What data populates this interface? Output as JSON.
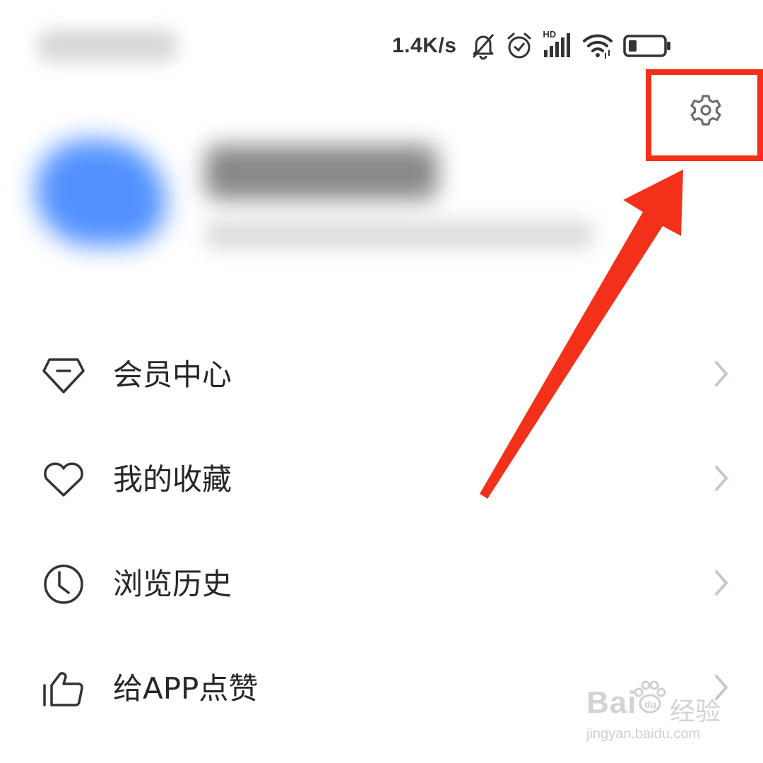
{
  "status_bar": {
    "net_speed": "1.4K/s",
    "icons": [
      "bell-muted-icon",
      "alarm-icon",
      "hd-signal-icon",
      "wifi-icon",
      "battery-icon"
    ],
    "hd_label": "HD"
  },
  "header": {
    "settings_icon": "gear-icon"
  },
  "menu": {
    "items": [
      {
        "label": "会员中心",
        "icon": "diamond-icon"
      },
      {
        "label": "我的收藏",
        "icon": "heart-icon"
      },
      {
        "label": "浏览历史",
        "icon": "clock-icon"
      },
      {
        "label": "给APP点赞",
        "icon": "thumbs-up-icon"
      }
    ]
  },
  "annotation": {
    "highlight_color": "#f3301a"
  },
  "watermark": {
    "brand_left": "Bai",
    "brand_right": "du",
    "suffix": "经验",
    "url": "jingyan.baidu.com"
  }
}
